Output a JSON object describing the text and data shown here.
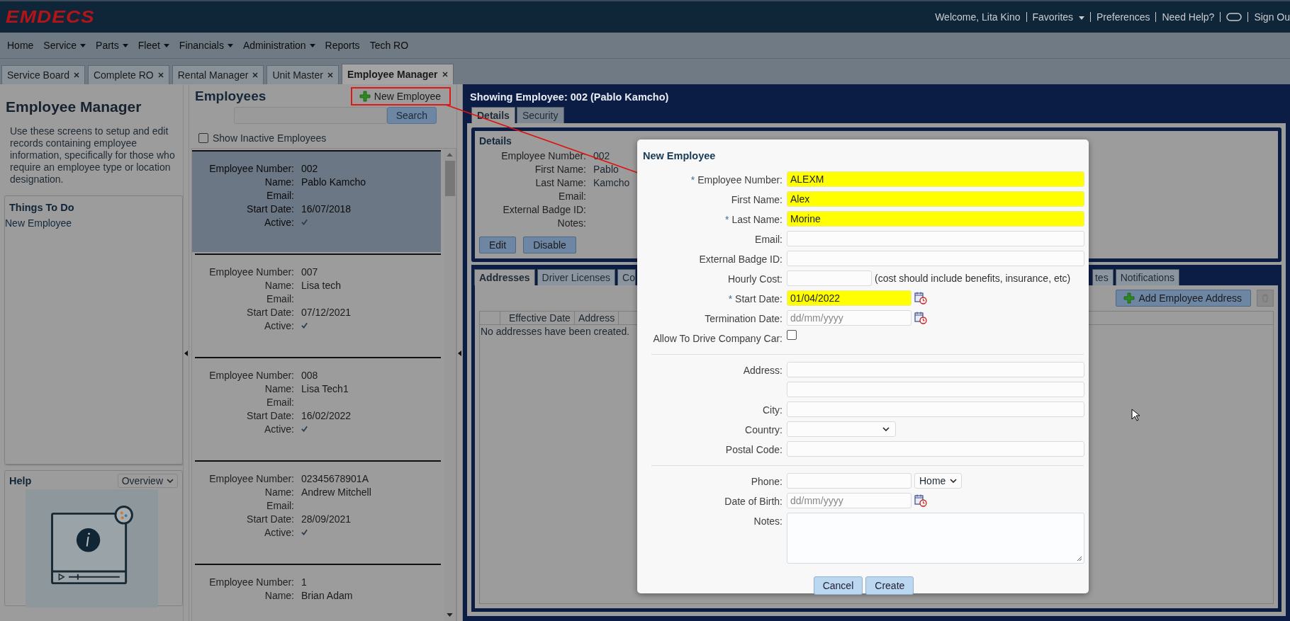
{
  "header": {
    "logo": "EMDECS",
    "links": [
      {
        "kind": "text",
        "label": "Welcome, Lita Kino"
      },
      {
        "kind": "menu",
        "label": "Favorites"
      },
      {
        "kind": "link",
        "label": "Preferences"
      },
      {
        "kind": "link",
        "label": "Need Help?"
      },
      {
        "kind": "icon"
      },
      {
        "kind": "link",
        "label": "Sign Ou"
      }
    ]
  },
  "menu": [
    {
      "label": "Home",
      "dropdown": false
    },
    {
      "label": "Service",
      "dropdown": true
    },
    {
      "label": "Parts",
      "dropdown": true
    },
    {
      "label": "Fleet",
      "dropdown": true
    },
    {
      "label": "Financials",
      "dropdown": true
    },
    {
      "label": "Administration",
      "dropdown": true
    },
    {
      "label": "Reports",
      "dropdown": false
    },
    {
      "label": "Tech RO",
      "dropdown": false
    }
  ],
  "tabs": [
    {
      "label": "Service Board",
      "selected": false
    },
    {
      "label": "Complete RO",
      "selected": false
    },
    {
      "label": "Rental Manager",
      "selected": false
    },
    {
      "label": "Unit Master",
      "selected": false
    },
    {
      "label": "Employee Manager",
      "selected": true
    }
  ],
  "sidebar": {
    "title": "Employee Manager",
    "description": "Use these screens to setup and edit records containing employee information, specifically for those who require an employee type or location designation.",
    "todo": {
      "title": "Things To Do",
      "items": [
        "New Employee"
      ]
    },
    "help": {
      "title": "Help",
      "select": "Overview"
    }
  },
  "employees": {
    "title": "Employees",
    "new_button": "New Employee",
    "search_button": "Search",
    "show_inactive": {
      "label": "Show Inactive Employees",
      "checked": false
    },
    "items": [
      {
        "selected": true,
        "fields": [
          {
            "kind": "text",
            "label": "Employee Number:",
            "value": "002"
          },
          {
            "kind": "text",
            "label": "Name:",
            "value": "Pablo Kamcho"
          },
          {
            "kind": "text",
            "label": "Email:"
          },
          {
            "kind": "text",
            "label": "Start Date:",
            "value": "16/07/2018"
          },
          {
            "kind": "check",
            "label": "Active:",
            "checked": true
          }
        ]
      },
      {
        "selected": false,
        "fields": [
          {
            "kind": "text",
            "label": "Employee Number:",
            "value": "007"
          },
          {
            "kind": "text",
            "label": "Name:",
            "value": "Lisa tech"
          },
          {
            "kind": "text",
            "label": "Email:"
          },
          {
            "kind": "text",
            "label": "Start Date:",
            "value": "07/12/2021"
          },
          {
            "kind": "check",
            "label": "Active:",
            "checked": true
          }
        ]
      },
      {
        "selected": false,
        "fields": [
          {
            "kind": "text",
            "label": "Employee Number:",
            "value": "008"
          },
          {
            "kind": "text",
            "label": "Name:",
            "value": "Lisa Tech1"
          },
          {
            "kind": "text",
            "label": "Email:"
          },
          {
            "kind": "text",
            "label": "Start Date:",
            "value": "16/02/2022"
          },
          {
            "kind": "check",
            "label": "Active:",
            "checked": true
          }
        ]
      },
      {
        "selected": false,
        "fields": [
          {
            "kind": "text",
            "label": "Employee Number:",
            "value": "02345678901A"
          },
          {
            "kind": "text",
            "label": "Name:",
            "value": "Andrew Mitchell"
          },
          {
            "kind": "text",
            "label": "Email:"
          },
          {
            "kind": "text",
            "label": "Start Date:",
            "value": "28/09/2021"
          },
          {
            "kind": "check",
            "label": "Active:",
            "checked": true
          }
        ]
      },
      {
        "selected": false,
        "fields": [
          {
            "kind": "text",
            "label": "Employee Number:",
            "value": "1"
          },
          {
            "kind": "text",
            "label": "Name:",
            "value": "Brian Adam"
          }
        ]
      }
    ]
  },
  "detail": {
    "title": "Showing Employee: 002 (Pablo Kamcho)",
    "tabs": [
      {
        "label": "Details",
        "selected": true
      },
      {
        "label": "Security",
        "selected": false
      }
    ],
    "section_title": "Details",
    "fields": [
      {
        "label": "Employee Number:",
        "value": "002"
      },
      {
        "label": "First Name:",
        "value": "Pablo"
      },
      {
        "label": "Last Name:",
        "value": "Kamcho"
      },
      {
        "label": "Email:"
      },
      {
        "label": "External Badge ID:"
      },
      {
        "label": "Notes:"
      }
    ],
    "buttons": [
      "Edit",
      "Disable"
    ],
    "subtabs": [
      {
        "label": "Addresses",
        "selected": true
      },
      {
        "label": "Driver Licenses",
        "selected": false
      },
      {
        "label": "Co",
        "selected": false
      },
      {
        "label": "tes",
        "selected": false
      },
      {
        "label": "Notifications",
        "selected": false
      }
    ],
    "add_button": "Add Employee Address",
    "columns": [
      "Effective Date",
      "Address"
    ],
    "empty": "No addresses have been created."
  },
  "modal": {
    "title": "New Employee",
    "fields": [
      {
        "kind": "text",
        "marker": "*",
        "label": "Employee Number:",
        "value": "ALEXM",
        "highlighted": true
      },
      {
        "kind": "text",
        "label": "First Name:",
        "value": "Alex",
        "highlighted": true
      },
      {
        "kind": "text",
        "marker": "*",
        "label": "Last Name:",
        "value": "Morine",
        "highlighted": true
      },
      {
        "kind": "text",
        "label": "Email:",
        "highlighted": false
      },
      {
        "kind": "text",
        "label": "External Badge ID:",
        "highlighted": false
      },
      {
        "kind": "short",
        "label": "Hourly Cost:",
        "note": "(cost should include benefits, insurance, etc)",
        "highlighted": false
      },
      {
        "kind": "date",
        "marker": "*",
        "label": "Start Date:",
        "value": "01/04/2022",
        "highlighted": true
      },
      {
        "kind": "date",
        "label": "Termination Date:",
        "placeholder": "dd/mm/yyyy",
        "highlighted": false
      },
      {
        "kind": "checkbox",
        "label": "Allow To Drive Company Car:",
        "checked": false
      },
      {
        "kind": "divider"
      },
      {
        "kind": "text",
        "label": "Address:",
        "highlighted": false
      },
      {
        "kind": "text",
        "highlighted": false
      },
      {
        "kind": "text",
        "label": "City:",
        "highlighted": false
      },
      {
        "kind": "select",
        "label": "Country:"
      },
      {
        "kind": "text",
        "label": "Postal Code:",
        "highlighted": false
      },
      {
        "kind": "divider"
      },
      {
        "kind": "phone",
        "label": "Phone:",
        "option": "Home",
        "highlighted": false
      },
      {
        "kind": "date",
        "label": "Date of Birth:",
        "placeholder": "dd/mm/yyyy",
        "highlighted": false
      },
      {
        "kind": "textarea",
        "label": "Notes:"
      }
    ],
    "buttons": [
      "Cancel",
      "Create"
    ]
  }
}
